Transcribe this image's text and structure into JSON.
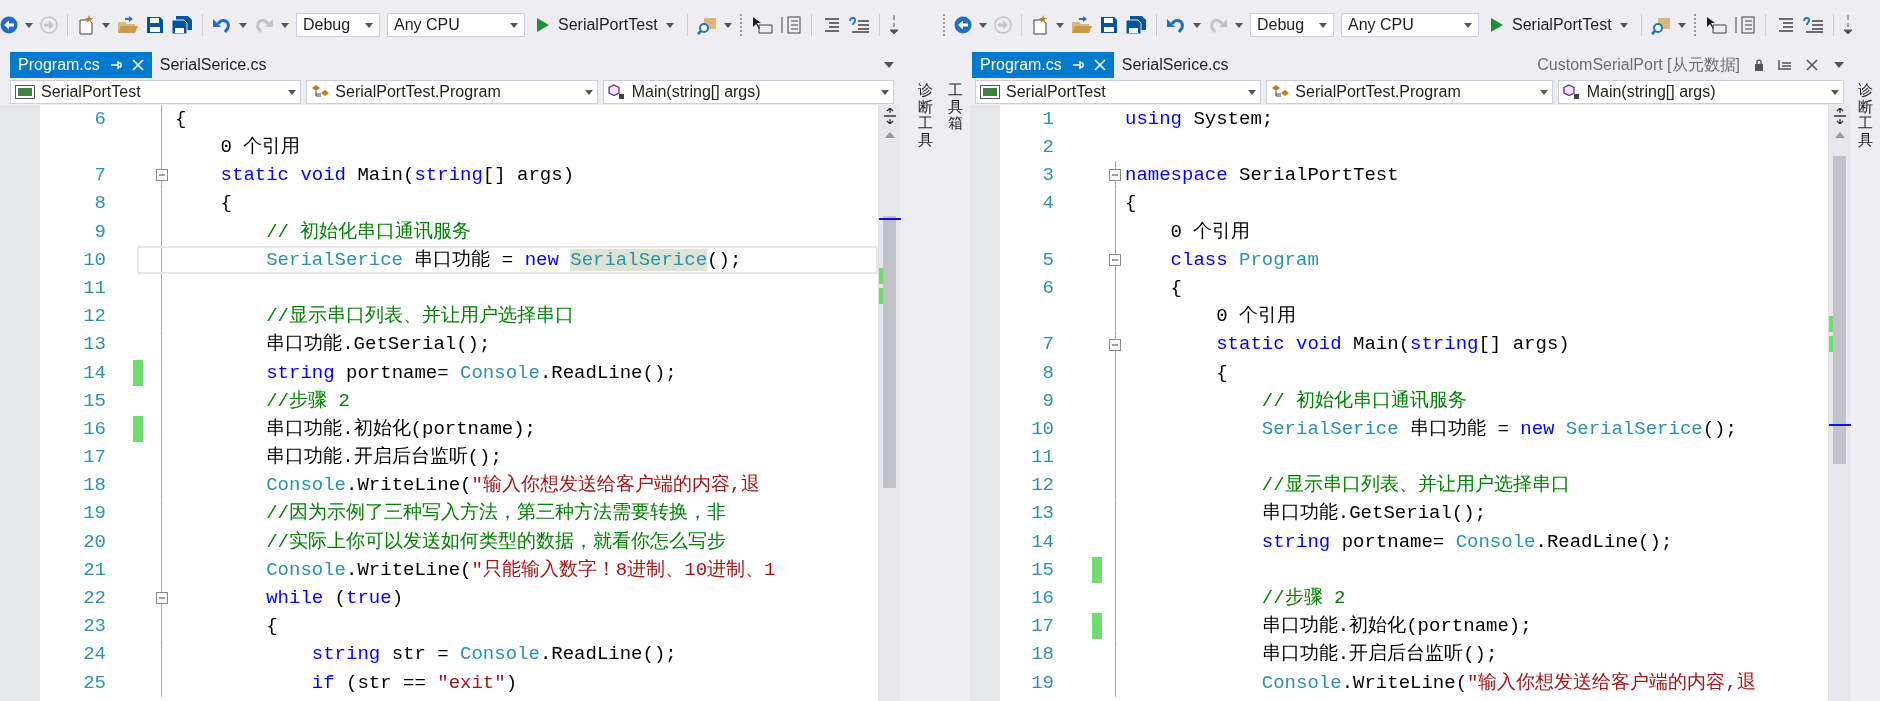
{
  "panes": [
    {
      "toolbar": {
        "configuration": "Debug",
        "platform": "Any CPU",
        "start_target": "SerialPortTest"
      },
      "right_side_tabs": [
        {
          "label": "诊断工具"
        }
      ],
      "tabs": [
        {
          "label": "Program.cs",
          "selected": true
        },
        {
          "label": "SerialSerice.cs",
          "selected": false
        }
      ],
      "navigation": {
        "project": "SerialPortTest",
        "type": "SerialPortTest.Program",
        "member": "Main(string[] args)"
      },
      "lines": [
        {
          "children": [
            {
              "number": "6",
              "changed": false,
              "fold": false,
              "current": false,
              "tokens": [
                {
                  "kind": "plain",
                  "text": "{"
                }
              ],
              "children": [
                {
                  "changed": false,
                  "fold": false,
                  "current": false,
                  "tokens": [
                    {
                      "kind": "plain",
                      "text": "0 个引用"
                    }
                  ]
                },
                {
                  "number": "7",
                  "changed": false,
                  "fold": true,
                  "current": false,
                  "tokens": [
                    {
                      "kind": "keyword",
                      "text": "static void"
                    },
                    {
                      "kind": "plain",
                      "text": " Main("
                    },
                    {
                      "kind": "keyword",
                      "text": "string"
                    },
                    {
                      "kind": "plain",
                      "text": "[] args)"
                    }
                  ]
                },
                {
                  "number": "8",
                  "changed": false,
                  "fold": false,
                  "current": false,
                  "tokens": [
                    {
                      "kind": "plain",
                      "text": "{"
                    }
                  ],
                  "children": [
                    {
                      "number": "9",
                      "changed": false,
                      "fold": false,
                      "current": false,
                      "tokens": [
                        {
                          "kind": "comment",
                          "text": "// 初始化串口通讯服务"
                        }
                      ]
                    },
                    {
                      "number": "10",
                      "changed": false,
                      "fold": false,
                      "current": true,
                      "tokens": [
                        {
                          "kind": "type",
                          "text": "SerialSerice"
                        },
                        {
                          "kind": "plain",
                          "text": " 串口功能 = "
                        },
                        {
                          "kind": "keyword",
                          "text": "new "
                        },
                        {
                          "kind": "highlight",
                          "text": "SerialSerice"
                        },
                        {
                          "kind": "plain",
                          "text": "();"
                        }
                      ]
                    },
                    {
                      "number": "11",
                      "changed": false,
                      "fold": false,
                      "current": false
                    },
                    {
                      "number": "12",
                      "changed": false,
                      "fold": false,
                      "current": false,
                      "tokens": [
                        {
                          "kind": "comment",
                          "text": "//显示串口列表、并让用户选择串口"
                        }
                      ]
                    },
                    {
                      "number": "13",
                      "changed": false,
                      "fold": false,
                      "current": false,
                      "tokens": [
                        {
                          "kind": "plain",
                          "text": "串口功能.GetSerial();"
                        }
                      ]
                    },
                    {
                      "number": "14",
                      "changed": true,
                      "fold": false,
                      "current": false,
                      "tokens": [
                        {
                          "kind": "keyword",
                          "text": "string"
                        },
                        {
                          "kind": "plain",
                          "text": " portname= "
                        },
                        {
                          "kind": "type",
                          "text": "Console"
                        },
                        {
                          "kind": "plain",
                          "text": ".ReadLine();"
                        }
                      ]
                    },
                    {
                      "number": "15",
                      "changed": false,
                      "fold": false,
                      "current": false,
                      "tokens": [
                        {
                          "kind": "comment",
                          "text": "//步骤 2"
                        }
                      ]
                    },
                    {
                      "number": "16",
                      "changed": true,
                      "fold": false,
                      "current": false,
                      "tokens": [
                        {
                          "kind": "plain",
                          "text": "串口功能.初始化(portname);"
                        }
                      ]
                    },
                    {
                      "number": "17",
                      "changed": false,
                      "fold": false,
                      "current": false,
                      "tokens": [
                        {
                          "kind": "plain",
                          "text": "串口功能.开启后台监听();"
                        }
                      ]
                    },
                    {
                      "number": "18",
                      "changed": false,
                      "fold": false,
                      "current": false,
                      "tokens": [
                        {
                          "kind": "type",
                          "text": "Console"
                        },
                        {
                          "kind": "plain",
                          "text": ".WriteLine("
                        },
                        {
                          "kind": "string",
                          "text": "\"输入你想发送给客户端的内容,退"
                        }
                      ]
                    },
                    {
                      "number": "19",
                      "changed": false,
                      "fold": false,
                      "current": false,
                      "tokens": [
                        {
                          "kind": "comment",
                          "text": "//因为示例了三种写入方法，第三种方法需要转换，非"
                        }
                      ]
                    },
                    {
                      "number": "20",
                      "changed": false,
                      "fold": false,
                      "current": false,
                      "tokens": [
                        {
                          "kind": "comment",
                          "text": "//实际上你可以发送如何类型的数据，就看你怎么写步"
                        }
                      ]
                    },
                    {
                      "number": "21",
                      "changed": false,
                      "fold": false,
                      "current": false,
                      "tokens": [
                        {
                          "kind": "type",
                          "text": "Console"
                        },
                        {
                          "kind": "plain",
                          "text": ".WriteLine("
                        },
                        {
                          "kind": "string",
                          "text": "\"只能输入数字！8进制、10进制、1"
                        }
                      ]
                    },
                    {
                      "number": "22",
                      "changed": false,
                      "fold": true,
                      "current": false,
                      "tokens": [
                        {
                          "kind": "keyword",
                          "text": "while"
                        },
                        {
                          "kind": "plain",
                          "text": " ("
                        },
                        {
                          "kind": "keyword",
                          "text": "true"
                        },
                        {
                          "kind": "plain",
                          "text": ")"
                        }
                      ]
                    },
                    {
                      "number": "23",
                      "changed": false,
                      "fold": false,
                      "current": false,
                      "tokens": [
                        {
                          "kind": "plain",
                          "text": "{"
                        }
                      ],
                      "children": [
                        {
                          "number": "24",
                          "changed": false,
                          "fold": false,
                          "current": false,
                          "tokens": [
                            {
                              "kind": "keyword",
                              "text": "string"
                            },
                            {
                              "kind": "plain",
                              "text": " str = "
                            },
                            {
                              "kind": "type",
                              "text": "Console"
                            },
                            {
                              "kind": "plain",
                              "text": ".ReadLine();"
                            }
                          ]
                        },
                        {
                          "number": "25",
                          "changed": false,
                          "fold": false,
                          "current": false,
                          "tokens": [
                            {
                              "kind": "keyword",
                              "text": "if"
                            },
                            {
                              "kind": "plain",
                              "text": " (str == "
                            },
                            {
                              "kind": "string",
                              "text": "\"exit\""
                            },
                            {
                              "kind": "plain",
                              "text": ")"
                            }
                          ]
                        }
                      ]
                    }
                  ]
                }
              ]
            }
          ]
        }
      ]
    },
    {
      "toolbar": {
        "configuration": "Debug",
        "platform": "Any CPU",
        "start_target": "SerialPortTest"
      },
      "left_side_tabs": [
        {
          "label": "工具箱"
        }
      ],
      "right_side_tabs": [
        {
          "label": "诊断工具"
        }
      ],
      "tabs": [
        {
          "label": "Program.cs",
          "selected": true
        },
        {
          "label": "SerialSerice.cs",
          "selected": false
        }
      ],
      "preview_tab": {
        "label": "CustomSerialPort [从元数据]"
      },
      "navigation": {
        "project": "SerialPortTest",
        "type": "SerialPortTest.Program",
        "member": "Main(string[] args)"
      },
      "lines": [
        {
          "number": "1",
          "changed": false,
          "fold": false,
          "current": false,
          "tokens": [
            {
              "kind": "keyword",
              "text": "using"
            },
            {
              "kind": "plain",
              "text": " System;"
            }
          ]
        },
        {
          "number": "2",
          "changed": false,
          "fold": false,
          "current": false
        },
        {
          "number": "3",
          "changed": false,
          "fold": true,
          "current": false,
          "tokens": [
            {
              "kind": "keyword",
              "text": "namespace"
            },
            {
              "kind": "plain",
              "text": " SerialPortTest"
            }
          ]
        },
        {
          "number": "4",
          "changed": false,
          "fold": false,
          "current": false,
          "tokens": [
            {
              "kind": "plain",
              "text": "{"
            }
          ],
          "children": [
            {
              "changed": false,
              "fold": false,
              "current": false,
              "tokens": [
                {
                  "kind": "plain",
                  "text": "0 个引用"
                }
              ]
            },
            {
              "number": "5",
              "changed": false,
              "fold": true,
              "current": false,
              "tokens": [
                {
                  "kind": "keyword",
                  "text": "class "
                },
                {
                  "kind": "type",
                  "text": "Program"
                }
              ]
            },
            {
              "number": "6",
              "changed": false,
              "fold": false,
              "current": false,
              "tokens": [
                {
                  "kind": "plain",
                  "text": "{"
                }
              ],
              "children": [
                {
                  "changed": false,
                  "fold": false,
                  "current": false,
                  "tokens": [
                    {
                      "kind": "plain",
                      "text": "0 个引用"
                    }
                  ]
                },
                {
                  "number": "7",
                  "changed": false,
                  "fold": true,
                  "current": false,
                  "tokens": [
                    {
                      "kind": "keyword",
                      "text": "static void"
                    },
                    {
                      "kind": "plain",
                      "text": " Main("
                    },
                    {
                      "kind": "keyword",
                      "text": "string"
                    },
                    {
                      "kind": "plain",
                      "text": "[] args)"
                    }
                  ]
                },
                {
                  "number": "8",
                  "changed": false,
                  "fold": false,
                  "current": false,
                  "tokens": [
                    {
                      "kind": "plain",
                      "text": "{"
                    }
                  ],
                  "children": [
                    {
                      "number": "9",
                      "changed": false,
                      "fold": false,
                      "current": false,
                      "tokens": [
                        {
                          "kind": "comment",
                          "text": "// 初始化串口通讯服务"
                        }
                      ]
                    },
                    {
                      "number": "10",
                      "changed": false,
                      "fold": false,
                      "current": false,
                      "tokens": [
                        {
                          "kind": "type",
                          "text": "SerialSerice"
                        },
                        {
                          "kind": "plain",
                          "text": " 串口功能 = "
                        },
                        {
                          "kind": "keyword",
                          "text": "new "
                        },
                        {
                          "kind": "type",
                          "text": "SerialSerice"
                        },
                        {
                          "kind": "plain",
                          "text": "();"
                        }
                      ]
                    },
                    {
                      "number": "11",
                      "changed": false,
                      "fold": false,
                      "current": false
                    },
                    {
                      "number": "12",
                      "changed": false,
                      "fold": false,
                      "current": false,
                      "tokens": [
                        {
                          "kind": "comment",
                          "text": "//显示串口列表、并让用户选择串口"
                        }
                      ]
                    },
                    {
                      "number": "13",
                      "changed": false,
                      "fold": false,
                      "current": false,
                      "tokens": [
                        {
                          "kind": "plain",
                          "text": "串口功能.GetSerial();"
                        }
                      ]
                    },
                    {
                      "number": "14",
                      "changed": false,
                      "fold": false,
                      "current": false,
                      "tokens": [
                        {
                          "kind": "keyword",
                          "text": "string"
                        },
                        {
                          "kind": "plain",
                          "text": " portname= "
                        },
                        {
                          "kind": "type",
                          "text": "Console"
                        },
                        {
                          "kind": "plain",
                          "text": ".ReadLine();"
                        }
                      ]
                    },
                    {
                      "number": "15",
                      "changed": true,
                      "fold": false,
                      "current": false
                    },
                    {
                      "number": "16",
                      "changed": false,
                      "fold": false,
                      "current": false,
                      "tokens": [
                        {
                          "kind": "comment",
                          "text": "//步骤 2"
                        }
                      ]
                    },
                    {
                      "number": "17",
                      "changed": true,
                      "fold": false,
                      "current": false,
                      "tokens": [
                        {
                          "kind": "plain",
                          "text": "串口功能.初始化(portname);"
                        }
                      ]
                    },
                    {
                      "number": "18",
                      "changed": false,
                      "fold": false,
                      "current": false,
                      "tokens": [
                        {
                          "kind": "plain",
                          "text": "串口功能.开启后台监听();"
                        }
                      ]
                    },
                    {
                      "number": "19",
                      "changed": false,
                      "fold": false,
                      "current": false,
                      "tokens": [
                        {
                          "kind": "type",
                          "text": "Console"
                        },
                        {
                          "kind": "plain",
                          "text": ".WriteLine("
                        },
                        {
                          "kind": "string",
                          "text": "\"输入你想发送给客户端的内容,退"
                        }
                      ]
                    }
                  ]
                }
              ]
            }
          ]
        }
      ]
    }
  ]
}
